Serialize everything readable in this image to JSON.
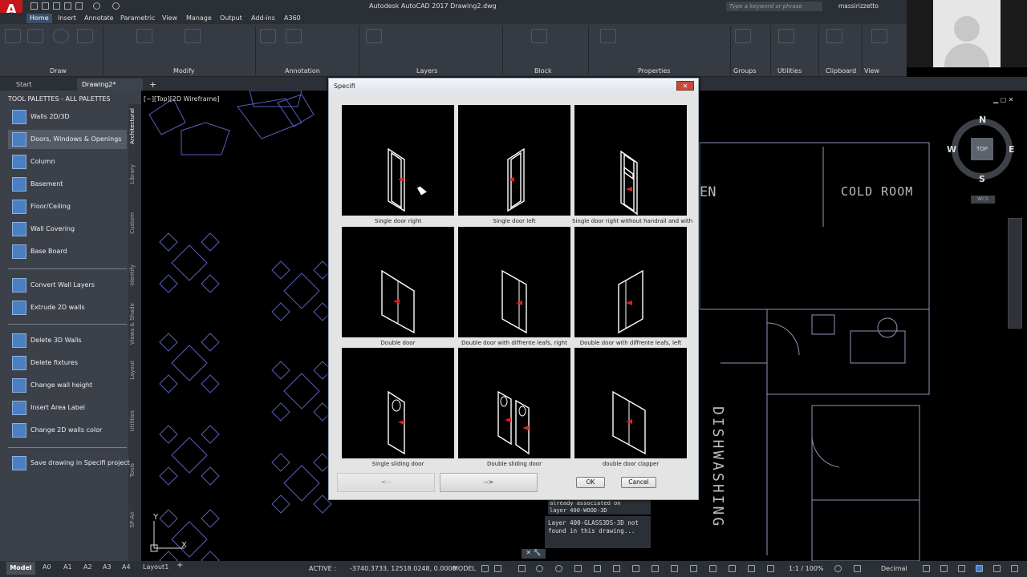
{
  "app": {
    "logo": "A",
    "title": "Autodesk AutoCAD 2017    Drawing2.dwg",
    "search_placeholder": "Type a keyword or phrase",
    "user": "massirizzetto"
  },
  "ribbon_tabs": [
    "Home",
    "Insert",
    "Annotate",
    "Parametric",
    "View",
    "Manage",
    "Output",
    "Add-ins",
    "A360"
  ],
  "ribbon_panels": [
    "Draw",
    "Modify",
    "Annotation",
    "Layers",
    "Block",
    "Properties",
    "Groups",
    "Utilities",
    "Clipboard",
    "View"
  ],
  "file_tabs": [
    "Start",
    "Drawing2*"
  ],
  "palette": {
    "title": "TOOL PALETTES - ALL PALETTES",
    "items": [
      "Walls 2D/3D",
      "Doors, Windows & Openings",
      "Column",
      "Basement",
      "Floor/Ceiling",
      "Wall Covering",
      "Base Board",
      "Convert Wall Layers",
      "Extrude 2D walls",
      "Delete 3D Walls",
      "Delete fixtures",
      "Change wall height",
      "Insert Area Label",
      "Change 2D walls color",
      "Save drawing in Specifi project"
    ],
    "side_tabs": [
      "Architectural",
      "Library",
      "Custom",
      "Identify",
      "Views & Shade",
      "Layout",
      "Utilities",
      "Tools",
      "SP-Air"
    ]
  },
  "viewport": {
    "label": "[−][Top][2D Wireframe]",
    "compass": {
      "n": "N",
      "s": "S",
      "e": "E",
      "w": "W",
      "top": "TOP"
    },
    "wcs": "WCS",
    "room_labels": {
      "cold_room": "COLD ROOM",
      "partial": "EN",
      "dishwashing": "DISHWASHING"
    },
    "axis": {
      "y": "Y",
      "x": "X"
    }
  },
  "command_history": {
    "line1": "already associated on",
    "line2": "layer 400-WOOD-3D",
    "line3": "Layer 400-GLASS3DS-3D not",
    "line4": "found in this drawing..."
  },
  "dialog": {
    "title": "Specifi",
    "close": "✕",
    "doors": [
      "Single door right",
      "Single door left",
      "Single door right without handrail and with",
      "Double door",
      "Double door with diffrente leafs, right",
      "Double door with diffrente leafs, left",
      "Single sliding door",
      "Double sliding door",
      "double door clapper"
    ],
    "prev_button": "<--",
    "next_button": "-->",
    "ok_button": "OK",
    "cancel_button": "Cancel"
  },
  "status": {
    "layout_tabs": [
      "Model",
      "A0",
      "A1",
      "A2",
      "A3",
      "A4",
      "Layout1"
    ],
    "active_label": "ACTIVE :",
    "coordinates": "-3740.3733, 12518.0248, 0.0000",
    "model": "MODEL",
    "scale": "1:1 / 100%",
    "units": "Decimal"
  }
}
